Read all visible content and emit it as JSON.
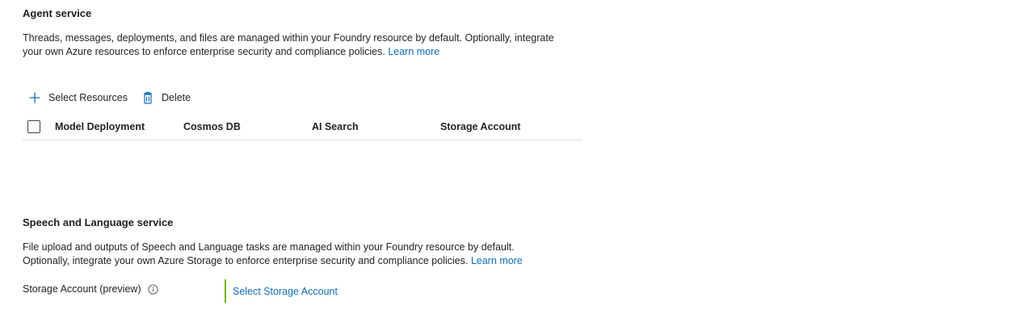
{
  "agent_service": {
    "title": "Agent service",
    "description_line1": "Threads, messages, deployments, and files are managed within your Foundry resource by default. Optionally, integrate",
    "description_line2": "your own Azure resources to enforce enterprise security and compliance policies.",
    "learn_more": "Learn more",
    "toolbar": {
      "select_resources_label": "Select Resources",
      "delete_label": "Delete",
      "select_resources_icon": "plus-icon",
      "delete_icon": "trash-icon"
    },
    "table": {
      "columns": [
        "Model Deployment",
        "Cosmos DB",
        "AI Search",
        "Storage Account"
      ],
      "rows": []
    }
  },
  "speech_language_service": {
    "title": "Speech and Language service",
    "description_line1": "File upload and outputs of Speech and Language tasks are managed within your Foundry resource by default.",
    "description_line2": "Optionally, integrate your own Azure Storage to enforce enterprise security and compliance policies.",
    "learn_more": "Learn more",
    "storage_account_label": "Storage Account (preview)",
    "info_icon": "info-icon",
    "select_storage_link": "Select Storage Account"
  },
  "colors": {
    "link": "#0f6cbd",
    "accent_bar": "#6bb700",
    "icon_blue": "#0f6cbd",
    "divider": "#e0e0e0"
  }
}
